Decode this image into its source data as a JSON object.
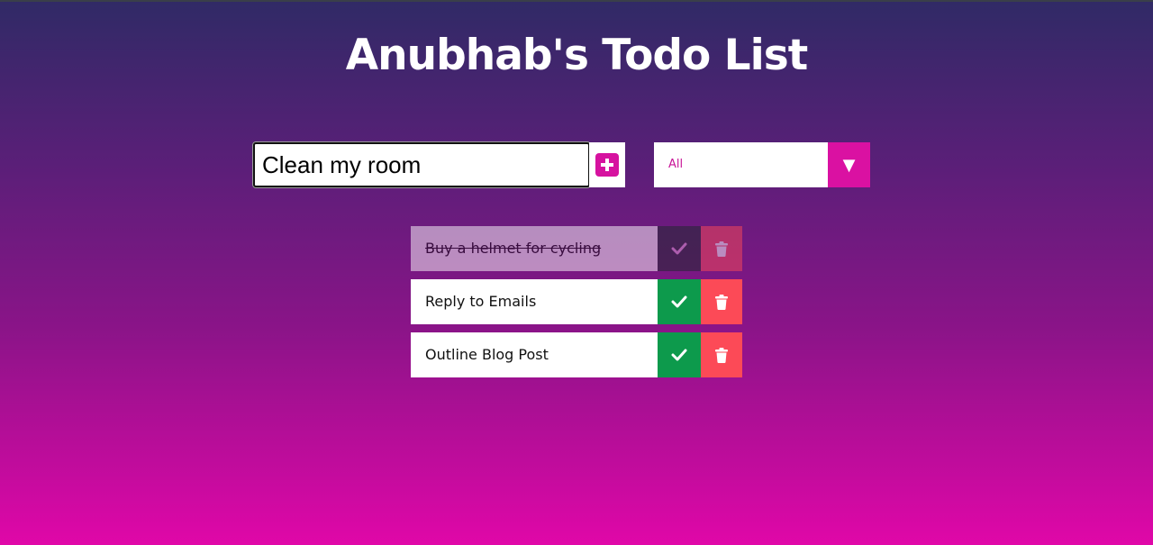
{
  "header": {
    "title": "Anubhab's Todo List"
  },
  "form": {
    "input_value": "Clean my room",
    "add_icon": "plus-square-icon",
    "filter": {
      "selected": "All",
      "options": [
        "All"
      ],
      "arrow_icon": "caret-down-icon"
    }
  },
  "todos": [
    {
      "text": "Buy a helmet for cycling",
      "completed": true
    },
    {
      "text": "Reply to Emails",
      "completed": false
    },
    {
      "text": "Outline Blog Post",
      "completed": false
    }
  ],
  "colors": {
    "accent": "#d6129f",
    "complete": "#0d9a4c",
    "delete": "#fc4a57"
  }
}
